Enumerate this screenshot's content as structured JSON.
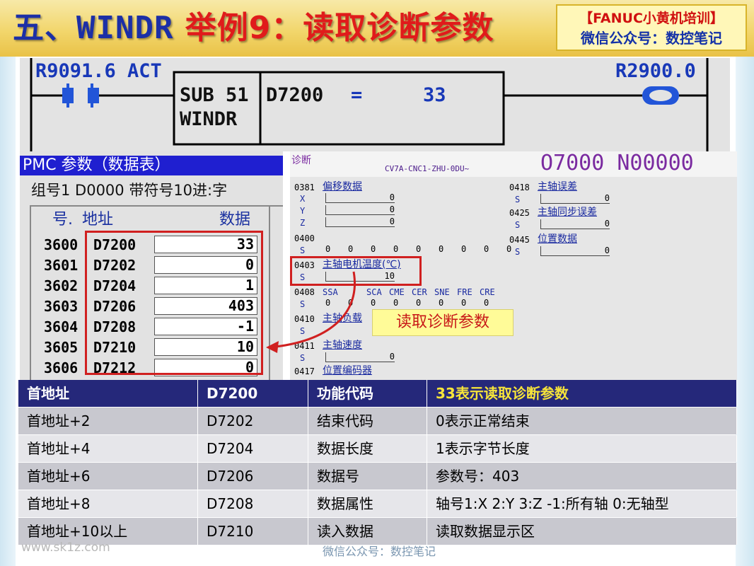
{
  "header": {
    "title_part1": "五、WINDR",
    "title_part2": "举例9：读取诊断参数",
    "brand_line1": "【FANUC小黄机培训】",
    "brand_line2": "微信公众号：数控笔记"
  },
  "ladder": {
    "contact_label": "R9091.6 ACT",
    "sub_func": "SUB 51",
    "sub_name": "WINDR",
    "param_addr": "D7200",
    "param_eq": "=",
    "param_val": "33",
    "coil_label": "R2900.0"
  },
  "pmc": {
    "title": "PMC 参数（数据表）",
    "subtitle": "组号1   D0000 带符号10进:字",
    "col_no": "号.",
    "col_addr": "地址",
    "col_data": "数据",
    "rows": [
      {
        "no": "3600",
        "addr": "D7200",
        "val": "33"
      },
      {
        "no": "3601",
        "addr": "D7202",
        "val": "0"
      },
      {
        "no": "3602",
        "addr": "D7204",
        "val": "1"
      },
      {
        "no": "3603",
        "addr": "D7206",
        "val": "403"
      },
      {
        "no": "3604",
        "addr": "D7208",
        "val": "-1"
      },
      {
        "no": "3605",
        "addr": "D7210",
        "val": "10"
      },
      {
        "no": "3606",
        "addr": "D7212",
        "val": "0"
      }
    ]
  },
  "diag": {
    "label": "诊断",
    "machine": "CV7A-CNC1-ZHU-0DU~",
    "prog": "O7000 N00000",
    "p381": "0381",
    "p381_name": "偏移数据",
    "axis_x": "X",
    "axis_y": "Y",
    "axis_z": "Z",
    "p381_vals": [
      "0",
      "0",
      "0"
    ],
    "p400": "0400",
    "s": "S",
    "p400_bits": [
      "0",
      "0",
      "0",
      "0",
      "0",
      "0",
      "0",
      "0",
      "0"
    ],
    "p403": "0403",
    "p403_name": "主轴电机温度(℃)",
    "p403_val": "10",
    "p408": "0408",
    "p408_hdr": [
      "SSA",
      "SCA",
      "CME",
      "CER",
      "SNE",
      "FRE",
      "CRE"
    ],
    "p408_bits": [
      "0",
      "0",
      "0",
      "0",
      "0",
      "0",
      "0",
      "0"
    ],
    "p410": "0410",
    "p410_name": "主轴负载",
    "p411": "0411",
    "p411_name": "主轴速度",
    "p411_val": "0",
    "p417": "0417",
    "p417_name": "位置编码器",
    "p418": "0418",
    "p418_name": "主轴误差",
    "p418_val": "0",
    "p425": "0425",
    "p425_name": "主轴同步误差",
    "p425_val": "0",
    "p445": "0445",
    "p445_name": "位置数据",
    "p445_val": "0",
    "annotation": "读取诊断参数"
  },
  "table": {
    "rows": [
      [
        "首地址",
        "D7200",
        "功能代码",
        "33表示读取诊断参数"
      ],
      [
        "首地址+2",
        "D7202",
        "结束代码",
        "0表示正常结束"
      ],
      [
        "首地址+4",
        "D7204",
        "数据长度",
        "1表示字节长度"
      ],
      [
        "首地址+6",
        "D7206",
        "数据号",
        "参数号：403"
      ],
      [
        "首地址+8",
        "D7208",
        "数据属性",
        "轴号1:X   2:Y  3:Z   -1:所有轴 0:无轴型"
      ],
      [
        "首地址+10以上",
        "D7210",
        "读入数据",
        "读取数据显示区"
      ]
    ]
  },
  "footer": {
    "watermark": "www.sk1z.com",
    "text": "微信公众号：数控笔记"
  }
}
